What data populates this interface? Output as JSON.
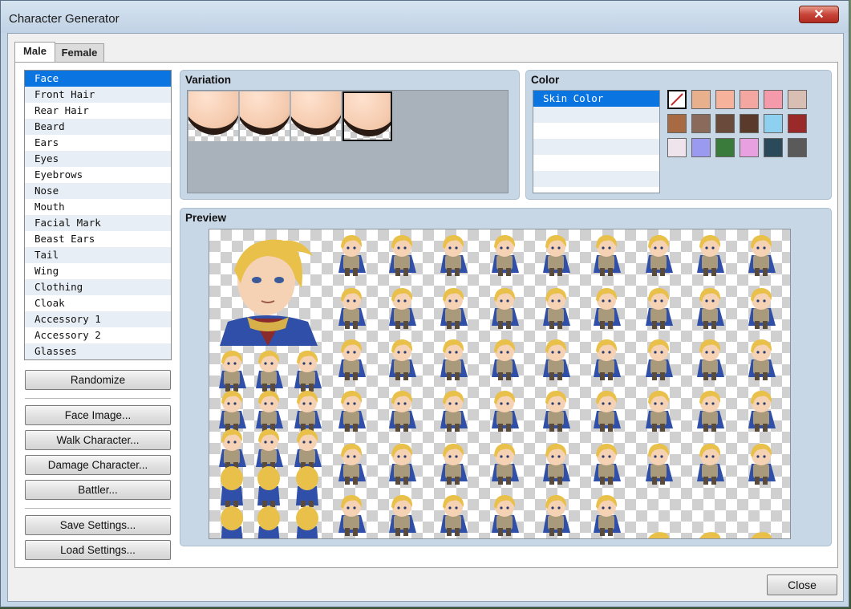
{
  "window": {
    "title": "Character Generator",
    "close_glyph": "✕"
  },
  "tabs": [
    {
      "label": "Male",
      "active": true
    },
    {
      "label": "Female",
      "active": false
    }
  ],
  "parts": {
    "selected": "Face",
    "items": [
      "Face",
      "Front Hair",
      "Rear Hair",
      "Beard",
      "Ears",
      "Eyes",
      "Eyebrows",
      "Nose",
      "Mouth",
      "Facial Mark",
      "Beast Ears",
      "Tail",
      "Wing",
      "Clothing",
      "Cloak",
      "Accessory 1",
      "Accessory 2",
      "Glasses"
    ]
  },
  "buttons": {
    "randomize": "Randomize",
    "face_image": "Face Image...",
    "walk_character": "Walk Character...",
    "damage_character": "Damage Character...",
    "battler": "Battler...",
    "save_settings": "Save Settings...",
    "load_settings": "Load Settings...",
    "close": "Close"
  },
  "variation": {
    "title": "Variation",
    "thumbs": 4,
    "selected_index": 3
  },
  "color": {
    "title": "Color",
    "items": [
      "Skin Color"
    ],
    "swatches": [
      "#ffffff",
      "#e8b08c",
      "#f6b29a",
      "#f4a6a0",
      "#f49aaa",
      "#d9bfb3",
      "#a86a42",
      "#8a6a5a",
      "#6a4a3a",
      "#5a3a2a",
      "#8ed0f0",
      "#9a2a2a",
      "#f0e4ec",
      "#9a9af0",
      "#3a7a3a",
      "#e8a0e0",
      "#2a4a5a",
      "#5a5a5a"
    ],
    "selected_swatch": 0
  },
  "preview": {
    "title": "Preview",
    "hair": "#e8c04a",
    "cloak": "#2f4fa8",
    "armor": "#a89a7a",
    "skin": "#f6d2b4"
  }
}
